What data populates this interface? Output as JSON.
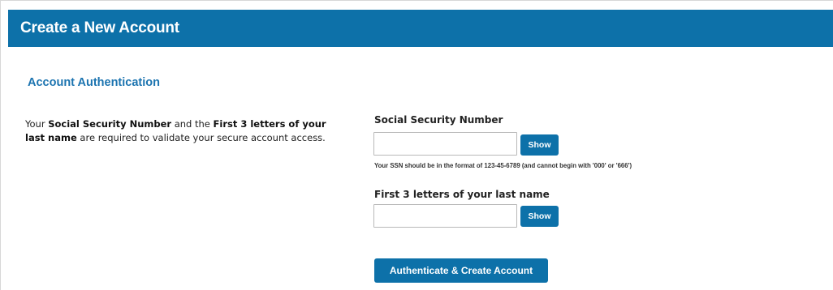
{
  "header": {
    "title": "Create a New Account"
  },
  "section": {
    "title": "Account Authentication"
  },
  "intro": {
    "part1": "Your ",
    "bold1": "Social Security Number",
    "part2": " and the ",
    "bold2": "First 3 letters of your last name",
    "part3": " are required to validate your secure account access."
  },
  "ssn": {
    "label": "Social Security Number",
    "value": "",
    "placeholder": "",
    "show_label": "Show",
    "hint": "Your SSN should be in the format of 123-45-6789 (and cannot begin with '000' or '666')"
  },
  "last_name": {
    "label": "First 3 letters of your last name",
    "value": "",
    "placeholder": "",
    "show_label": "Show"
  },
  "submit": {
    "label": "Authenticate & Create Account"
  },
  "colors": {
    "brand": "#0d71a9",
    "section_title": "#1c74b0"
  }
}
